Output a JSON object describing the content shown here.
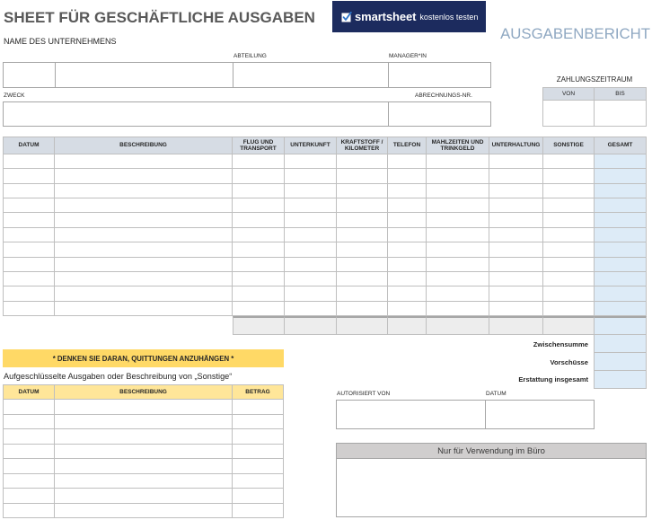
{
  "header": {
    "title": "SHEET FÜR GESCHÄFTLICHE AUSGABEN",
    "report_label": "AUSGABENBERICHT"
  },
  "banner": {
    "brand": "smartsheet",
    "cta": "kostenlos testen",
    "icon": "check-square-icon"
  },
  "company": {
    "name_label": "NAME DES UNTERNEHMENS",
    "department_label": "ABTEILUNG",
    "manager_label": "MANAGER*IN"
  },
  "purpose": {
    "purpose_label": "ZWECK",
    "report_number_label": "ABRECHNUNGS-NR."
  },
  "payment_period": {
    "label": "ZAHLUNGSZEITRAUM",
    "from_label": "VON",
    "to_label": "BIS"
  },
  "expense_table": {
    "columns": [
      "DATUM",
      "BESCHREIBUNG",
      "FLUG UND TRANSPORT",
      "UNTERKUNFT",
      "KRAFTSTOFF / KILOMETER",
      "TELEFON",
      "MAHLZEITEN UND TRINKGELD",
      "UNTERHALTUNG",
      "SONSTIGE",
      "GESAMT"
    ]
  },
  "summary": {
    "subtotal_label": "Zwischensumme",
    "advances_label": "Vorschüsse",
    "total_refund_label": "Erstattung insgesamt"
  },
  "reminder": "* DENKEN SIE DARAN, QUITTUNGEN ANZUHÄNGEN *",
  "itemized": {
    "label": "Aufgeschlüsselte Ausgaben oder Beschreibung von „Sonstige“",
    "columns": [
      "DATUM",
      "BESCHREIBUNG",
      "BETRAG"
    ]
  },
  "authorization": {
    "authorized_by_label": "AUTORISIERT VON",
    "date_label": "DATUM"
  },
  "office_use": {
    "label": "Nur für Verwendung im Büro"
  },
  "colors": {
    "title": "#595959",
    "report_label": "#8FA8C2",
    "banner_bg": "#1C2B5E",
    "header_fill": "#D6DCE4",
    "total_fill": "#DDEBF7",
    "sum_fill": "#EDEDED",
    "reminder_fill": "#FFD966",
    "itemized_header_fill": "#FFE699",
    "office_header_fill": "#D0CECE",
    "grid_line": "#BFBFBF",
    "box_line": "#A6A6A6"
  }
}
